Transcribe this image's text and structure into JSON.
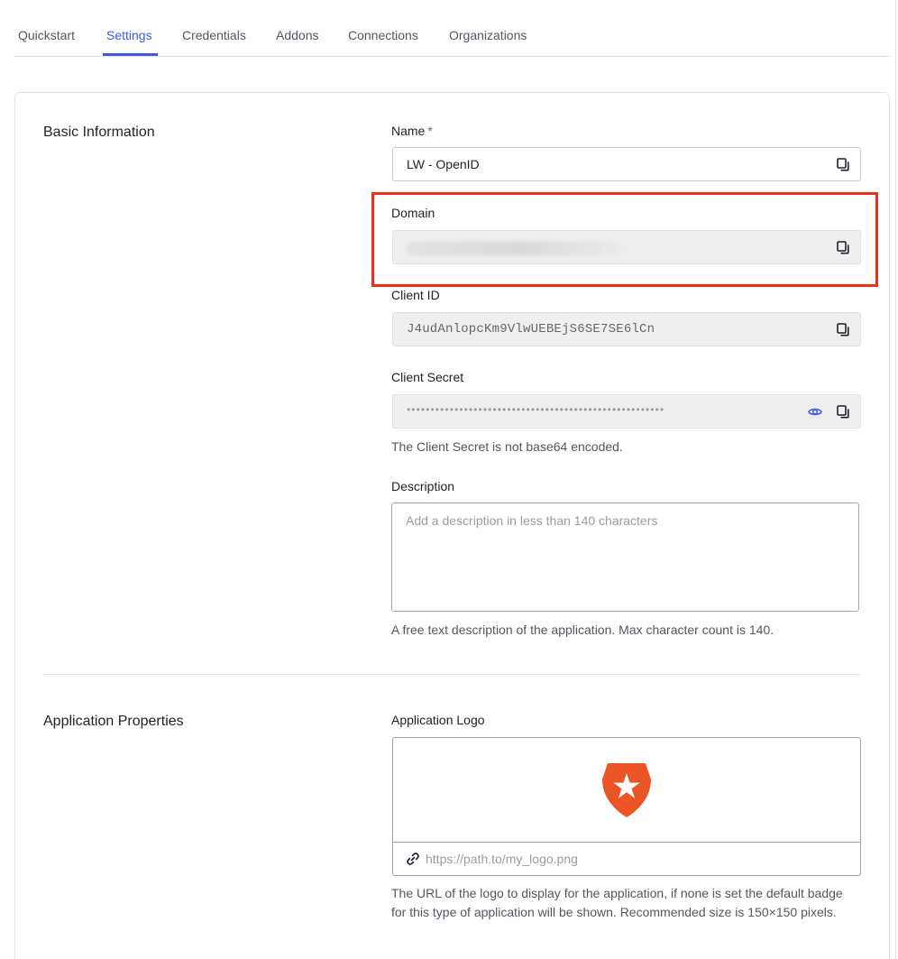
{
  "tabs": [
    {
      "label": "Quickstart"
    },
    {
      "label": "Settings"
    },
    {
      "label": "Credentials"
    },
    {
      "label": "Addons"
    },
    {
      "label": "Connections"
    },
    {
      "label": "Organizations"
    }
  ],
  "active_tab": "Settings",
  "basic_information": {
    "title": "Basic Information",
    "name": {
      "label": "Name",
      "required_mark": "*",
      "value": "LW - OpenID"
    },
    "domain": {
      "label": "Domain"
    },
    "client_id": {
      "label": "Client ID",
      "value": "J4udAnlopcKm9VlwUEBEjS6SE7SE6lCn"
    },
    "client_secret": {
      "label": "Client Secret",
      "masked_value": "••••••••••••••••••••••••••••••••••••••••••••••••••••••",
      "help": "The Client Secret is not base64 encoded."
    },
    "description": {
      "label": "Description",
      "placeholder": "Add a description in less than 140 characters",
      "help": "A free text description of the application. Max character count is 140."
    }
  },
  "application_properties": {
    "title": "Application Properties",
    "logo": {
      "label": "Application Logo",
      "url_placeholder": "https://path.to/my_logo.png",
      "help": "The URL of the logo to display for the application, if none is set the default badge for this type of application will be shown. Recommended size is 150×150 pixels."
    }
  },
  "colors": {
    "accent": "#3f59e4",
    "highlight": "#f02d1a",
    "logo": "#eb5424"
  },
  "icons": [
    "copy-icon",
    "eye-icon",
    "link-icon",
    "auth0-shield-star-logo"
  ]
}
